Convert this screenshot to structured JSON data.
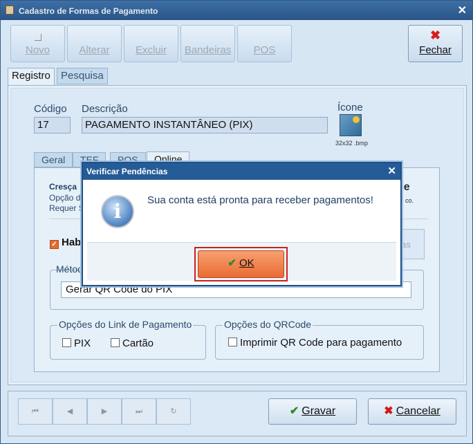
{
  "window": {
    "title": "Cadastro de Formas de Pagamento",
    "close": "✕"
  },
  "toolbar": {
    "novo": "Novo",
    "alterar": "Alterar",
    "excluir": "Excluir",
    "bandeiras": "Bandeiras",
    "pos": "POS",
    "fechar": "Fechar",
    "fechar_icon": "✖"
  },
  "tabs": {
    "registro": "Registro",
    "pesquisa": "Pesquisa"
  },
  "form": {
    "codigo_label": "Código",
    "codigo_value": "17",
    "descricao_label": "Descrição",
    "descricao_value": "PAGAMENTO INSTANTÂNEO (PIX)",
    "icone_label": "Ícone",
    "icone_caption": "32x32 .bmp"
  },
  "subtabs": {
    "geral": "Geral",
    "tef": "TEF",
    "pos": "POS",
    "online": "Online"
  },
  "online": {
    "header_bold": "Cresça",
    "line1": "Opção de",
    "line2": "Requer S",
    "logo_text": "ne",
    "logo_sub": "co.",
    "habilitar_label": "Hab",
    "as_button": "as",
    "metodo_label": "Métod",
    "metodo_value": "Gerar QR Code do PIX",
    "link_group_title": "Opções do Link de Pagamento",
    "pix_label": "PIX",
    "cartao_label": "Cartão",
    "qrcode_group_title": "Opções do QRCode",
    "imprimir_label": "Imprimir QR Code para pagamento"
  },
  "footer": {
    "nav_first": "⏮",
    "nav_prev": "◀",
    "nav_next": "▶",
    "nav_last": "⏭",
    "nav_refresh": "↻",
    "gravar": "Gravar",
    "gravar_icon": "✔",
    "cancelar": "Cancelar",
    "cancelar_icon": "✖"
  },
  "dialog": {
    "title": "Verificar Pendências",
    "close": "✕",
    "info_icon": "i",
    "message": "Sua conta está pronta para receber pagamentos!",
    "ok_label": "OK",
    "ok_icon": "✔"
  },
  "colors": {
    "accent_orange": "#ea6b34",
    "dialog_title": "#255c98",
    "highlight_red": "#cc1f1f"
  }
}
